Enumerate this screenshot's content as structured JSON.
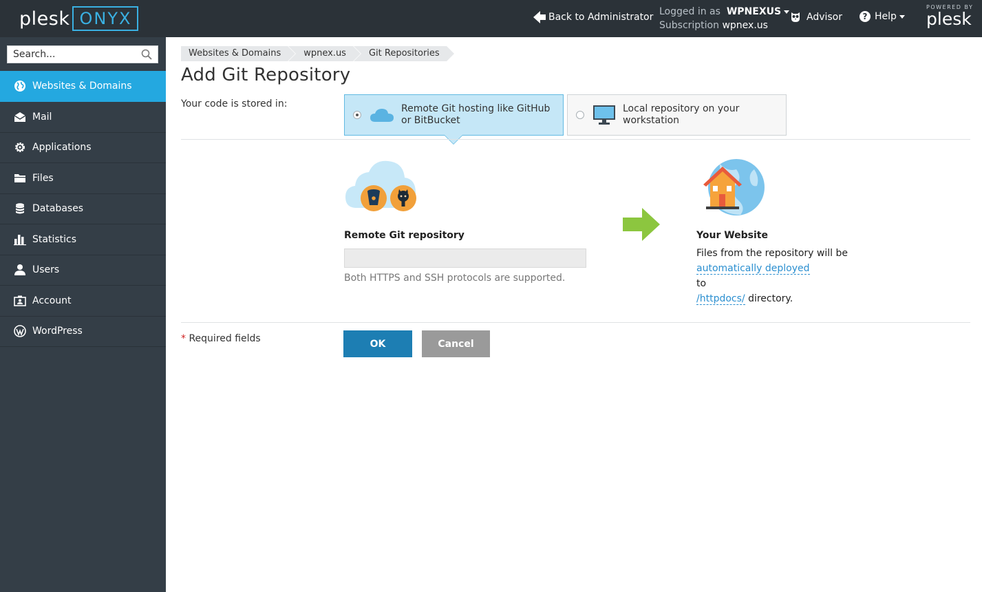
{
  "header": {
    "logo": "plesk",
    "edition": "ONYX",
    "back_label": "Back to Administrator",
    "logged_in_label": "Logged in as",
    "logged_in_user": "WPNEXUS",
    "subscription_label": "Subscription",
    "subscription_value": "wpnex.us",
    "advisor_label": "Advisor",
    "help_label": "Help",
    "powered_by": "POWERED BY",
    "powered_logo": "plesk"
  },
  "sidebar": {
    "search_placeholder": "Search...",
    "items": [
      {
        "label": "Websites & Domains",
        "icon": "globe-icon",
        "active": true
      },
      {
        "label": "Mail",
        "icon": "mail-icon"
      },
      {
        "label": "Applications",
        "icon": "gear-icon"
      },
      {
        "label": "Files",
        "icon": "folder-icon"
      },
      {
        "label": "Databases",
        "icon": "database-icon"
      },
      {
        "label": "Statistics",
        "icon": "bar-chart-icon"
      },
      {
        "label": "Users",
        "icon": "user-icon"
      },
      {
        "label": "Account",
        "icon": "account-icon"
      },
      {
        "label": "WordPress",
        "icon": "wordpress-icon"
      }
    ]
  },
  "breadcrumb": [
    "Websites & Domains",
    "wpnex.us",
    "Git Repositories"
  ],
  "page": {
    "title": "Add Git Repository",
    "stored_label": "Your code is stored in:",
    "option_remote": "Remote Git hosting like GitHub or BitBucket",
    "option_local": "Local repository on your workstation",
    "remote_label": "Remote Git repository",
    "repo_value": "",
    "hint": "Both HTTPS and SSH protocols are supported.",
    "website_title": "Your Website",
    "website_line1": "Files from the repository will be",
    "website_link1": "automatically deployed",
    "website_line2": "to",
    "website_link2": "/httpdocs/",
    "website_line3": "directory.",
    "required_star": "*",
    "required_label": "Required fields",
    "ok_label": "OK",
    "cancel_label": "Cancel"
  },
  "colors": {
    "topbar": "#2b3238",
    "sidebar": "#343e47",
    "active_item": "#24a8e0",
    "ok_button": "#1d7eb3",
    "cancel_button": "#9a9a9a",
    "link": "#2b8fd0"
  }
}
